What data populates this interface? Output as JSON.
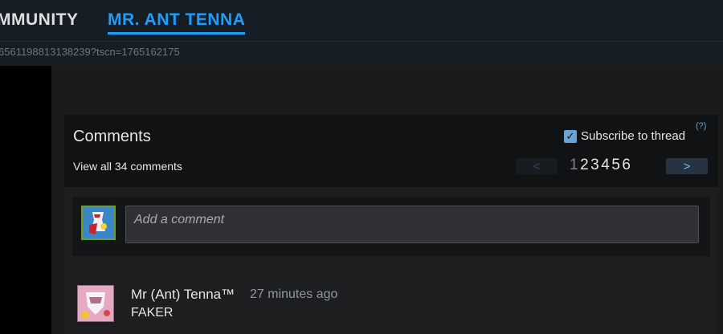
{
  "nav": {
    "community_tab": "MMUNITY",
    "profile_tab": "MR. ANT TENNA"
  },
  "url_text": "6561198813138239?tscn=1765162175",
  "comments": {
    "title": "Comments",
    "view_all": "View all 34 comments",
    "subscribe_label": "Subscribe to thread",
    "subscribe_checked": true,
    "help": "(?)",
    "pager": {
      "prev": "<",
      "next": ">",
      "pages": [
        "1",
        "2",
        "3",
        "4",
        "5",
        "6"
      ],
      "current": "1"
    },
    "composer": {
      "placeholder": "Add a comment"
    },
    "items": [
      {
        "author": "Mr (Ant) Tenna™",
        "timestamp": "27 minutes ago",
        "text": "FAKER"
      }
    ]
  },
  "colors": {
    "accent": "#1a9fff",
    "header_bg": "#171d25",
    "panel_bg": "#1d1e20",
    "panel_head_bg": "#111214"
  }
}
